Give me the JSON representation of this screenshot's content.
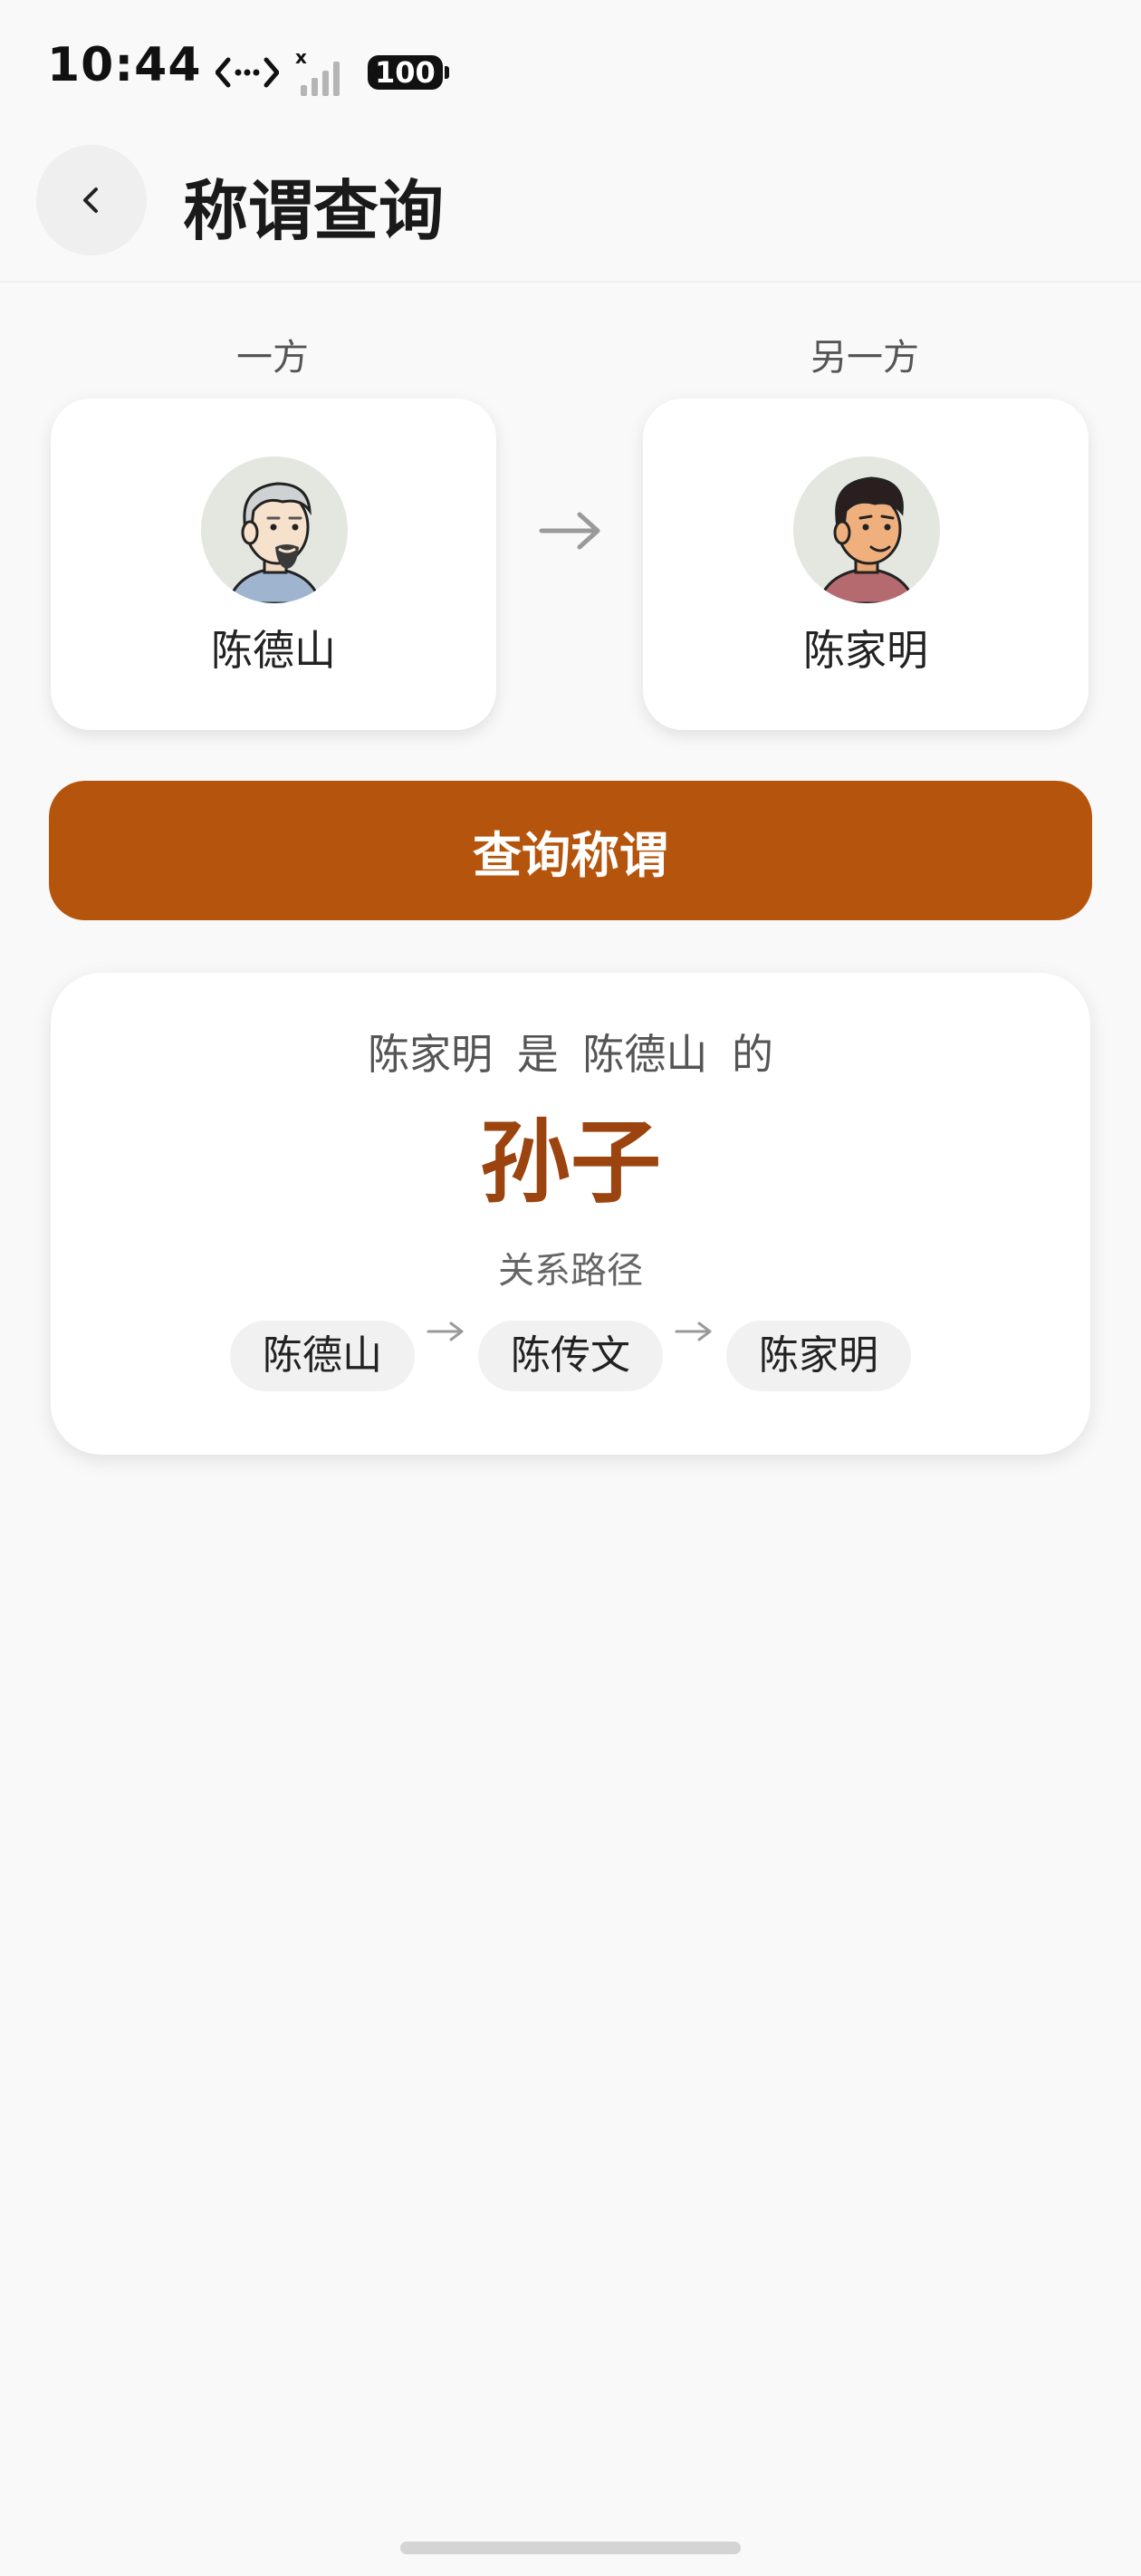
{
  "status_bar": {
    "time": "10:44",
    "battery": "100",
    "icons": [
      "data-transfer-icon",
      "no-signal-icon",
      "battery-icon"
    ]
  },
  "header": {
    "title": "称谓查询",
    "back_icon": "chevron-left-icon"
  },
  "parties": {
    "from": {
      "label": "一方",
      "name": "陈德山",
      "avatar": "old-man-avatar"
    },
    "to": {
      "label": "另一方",
      "name": "陈家明",
      "avatar": "young-man-avatar"
    },
    "arrow_icon": "arrow-right-icon"
  },
  "query_button": {
    "label": "查询称谓"
  },
  "result": {
    "subject": "陈家明",
    "is": "是",
    "object": "陈德山",
    "of": "的",
    "title": "孙子",
    "path_label": "关系路径",
    "path": [
      "陈德山",
      "陈传文",
      "陈家明"
    ]
  },
  "colors": {
    "accent": "#b5540d",
    "result_title": "#9c4410",
    "background": "#f9f9f9",
    "card": "#ffffff"
  }
}
